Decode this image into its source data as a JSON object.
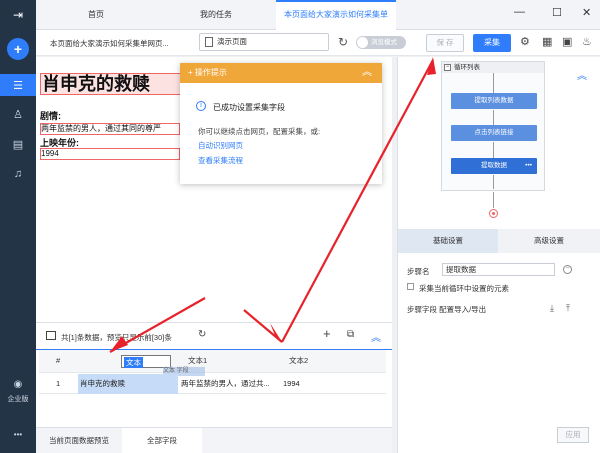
{
  "sidebar": {
    "logo_icon": "collapse-menu-icon",
    "add_icon": "plus-icon",
    "items": [
      {
        "icon": "list-icon",
        "glyph": "☰"
      },
      {
        "icon": "users-icon",
        "glyph": "♙"
      },
      {
        "icon": "book-icon",
        "glyph": "▤"
      },
      {
        "icon": "headset-icon",
        "glyph": "♫"
      }
    ],
    "account_label": "企业版",
    "more_label": "•••"
  },
  "tabs": [
    {
      "label": "首页"
    },
    {
      "label": "我的任务"
    },
    {
      "label": "本页面给大家演示如何采集单"
    }
  ],
  "window_controls": {
    "min": "—",
    "max": "☐",
    "close": "✕"
  },
  "toolbar": {
    "page_title": "本页面给大家演示如何采集单网页...",
    "url": "演示页面",
    "toggle_label": "浏览模式",
    "save_label": "保 存",
    "collect_label": "采集"
  },
  "webpage": {
    "movie_title": "肖申克的救赎",
    "plot_label": "剧情:",
    "plot_text": "两年监禁的男人，通过其同的尊严",
    "year_label": "上映年份:",
    "year_value": "1994"
  },
  "tip": {
    "header": "操作提示",
    "success": "已成功设置采集字段",
    "hint": "你可以继续点击网页，配置采集，或:",
    "link1": "自动识别网页",
    "link2": "查看采集流程"
  },
  "data_panel": {
    "info": "共[1]条数据，预览只显示前[30]条",
    "columns": [
      "#",
      "文本",
      "文本1",
      "文本2"
    ],
    "rows": [
      [
        "1",
        "肖申克的救赎",
        "两年监禁的男人，通过共...",
        "1994"
      ]
    ],
    "drag_ghost": "文本 字段"
  },
  "bottom_tabs": [
    "当前页面数据预览",
    "全部字段"
  ],
  "workflow": {
    "loop_label": "循环列表",
    "steps": [
      "提取列表数据",
      "点击列表链接",
      "提取数据"
    ],
    "active_step_more": "•••"
  },
  "settings": {
    "tabs": [
      "基础设置",
      "高级设置"
    ],
    "step_name_label": "步骤名",
    "step_name_value": "提取数据",
    "checkbox_label": "采集当前循环中设置的元素",
    "fields_label": "步骤字段 配置导入/导出",
    "apply_label": "应用"
  }
}
